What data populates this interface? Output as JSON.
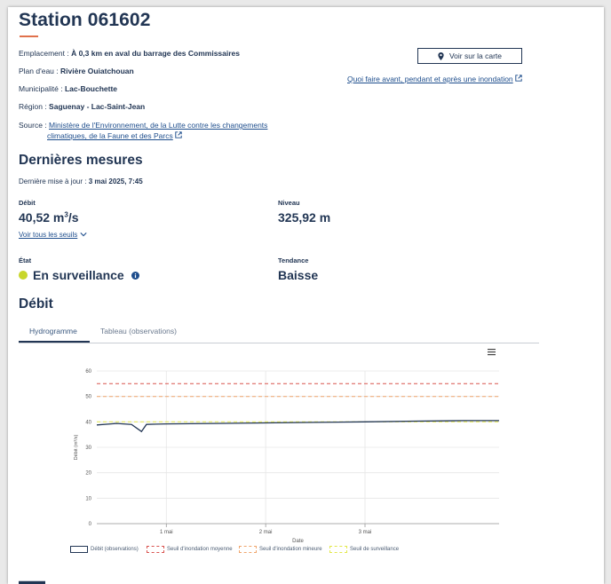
{
  "station": {
    "title": "Station 061602"
  },
  "info": {
    "emplacement_label": "Emplacement :",
    "emplacement_value": "À 0,3 km en aval du barrage des Commissaires",
    "plan_label": "Plan d'eau :",
    "plan_value": "Rivière Ouiatchouan",
    "municipalite_label": "Municipalité :",
    "municipalite_value": "Lac-Bouchette",
    "region_label": "Région :",
    "region_value": "Saguenay - Lac-Saint-Jean",
    "source_label": "Source :",
    "source_line1": "Ministère de l'Environnement, de la Lutte contre les changements",
    "source_line2": "climatiques, de la Faune et des Parcs"
  },
  "actions": {
    "map_button": "Voir sur la carte",
    "flood_link": "Quoi faire avant, pendant et après une inondation"
  },
  "mesures": {
    "heading": "Dernières mesures",
    "update_label": "Dernière mise à jour :",
    "update_value": "3 mai 2025, 7:45",
    "debit_label": "Débit",
    "debit_value": "40,52 m",
    "debit_unit_sup": "3",
    "debit_unit_tail": "/s",
    "niveau_label": "Niveau",
    "niveau_value": "325,92 m",
    "seuils_link": "Voir tous les seuils",
    "etat_label": "État",
    "etat_value": "En surveillance",
    "etat_color": "#c8d62b",
    "tendance_label": "Tendance",
    "tendance_value": "Baisse"
  },
  "debit_section": {
    "heading": "Débit",
    "tabs": [
      "Hydrogramme",
      "Tableau (observations)"
    ]
  },
  "chart_data": {
    "type": "line",
    "xlabel": "Date",
    "ylabel": "Débit (m³/s)",
    "ylim": [
      0,
      60
    ],
    "yticks": [
      0,
      10,
      20,
      30,
      40,
      50,
      60
    ],
    "xticks": [
      "1 mai",
      "2 mai",
      "3 mai"
    ],
    "x_start_day": 29.3,
    "x_end_day": 33.35,
    "tick_days": [
      30,
      31,
      32
    ],
    "grid": true,
    "series": [
      {
        "name": "Débit (observations)",
        "color": "#223654",
        "dash": "none",
        "x": [
          29.3,
          29.5,
          29.65,
          29.75,
          29.8,
          29.9,
          30.0,
          30.5,
          31.0,
          31.5,
          32.0,
          32.5,
          33.0,
          33.35
        ],
        "y": [
          38.8,
          39.4,
          39.0,
          36.2,
          39.0,
          39.1,
          39.2,
          39.4,
          39.6,
          39.8,
          40.0,
          40.3,
          40.5,
          40.5
        ]
      },
      {
        "name": "Seuil d'inondation moyenne",
        "color": "#d9534f",
        "dash": "4,3",
        "x": [
          29.3,
          33.35
        ],
        "y": [
          55,
          55
        ]
      },
      {
        "name": "Seuil d'inondation mineure",
        "color": "#f0a56c",
        "dash": "4,3",
        "x": [
          29.3,
          33.35
        ],
        "y": [
          50,
          50
        ]
      },
      {
        "name": "Seuil de surveillance",
        "color": "#e3e84a",
        "dash": "4,3",
        "x": [
          29.3,
          33.35
        ],
        "y": [
          40,
          40
        ]
      }
    ]
  }
}
